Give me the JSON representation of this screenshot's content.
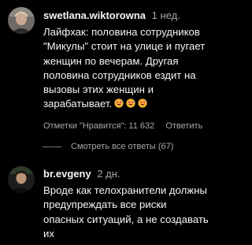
{
  "comments": [
    {
      "username": "swetlana.wiktorowna",
      "time": "1 нед.",
      "text_lines": [
        "Лайфхак: половина сотрудников",
        "\"Микулы\" стоит на улице и пугает",
        "женщин по вечерам. Другая",
        "половина сотрудников ездит на",
        "вызовы этих женщин и",
        "зарабатывает."
      ],
      "emoji": [
        "grinning-sweat-emoji",
        "grinning-sweat-emoji",
        "grinning-sweat-emoji"
      ],
      "likes": "Отметки \"Нравится\": 11 632",
      "reply": "Ответить"
    },
    {
      "username": "br.evgeny",
      "time": "2 дн.",
      "text_lines": [
        "Вроде как телохранители должны",
        "предупреждать все риски",
        "опасных ситуаций, а не создавать",
        "их"
      ]
    }
  ],
  "view_replies": "Смотреть все ответы (67)",
  "colors": {
    "background": "#000000",
    "primary_text": "#f5f5f5",
    "secondary_text": "#a8a8a8",
    "emoji_face": "#f7b52c",
    "emoji_eyes": "#e0457b",
    "emoji_sweat": "#5aa8e6"
  }
}
